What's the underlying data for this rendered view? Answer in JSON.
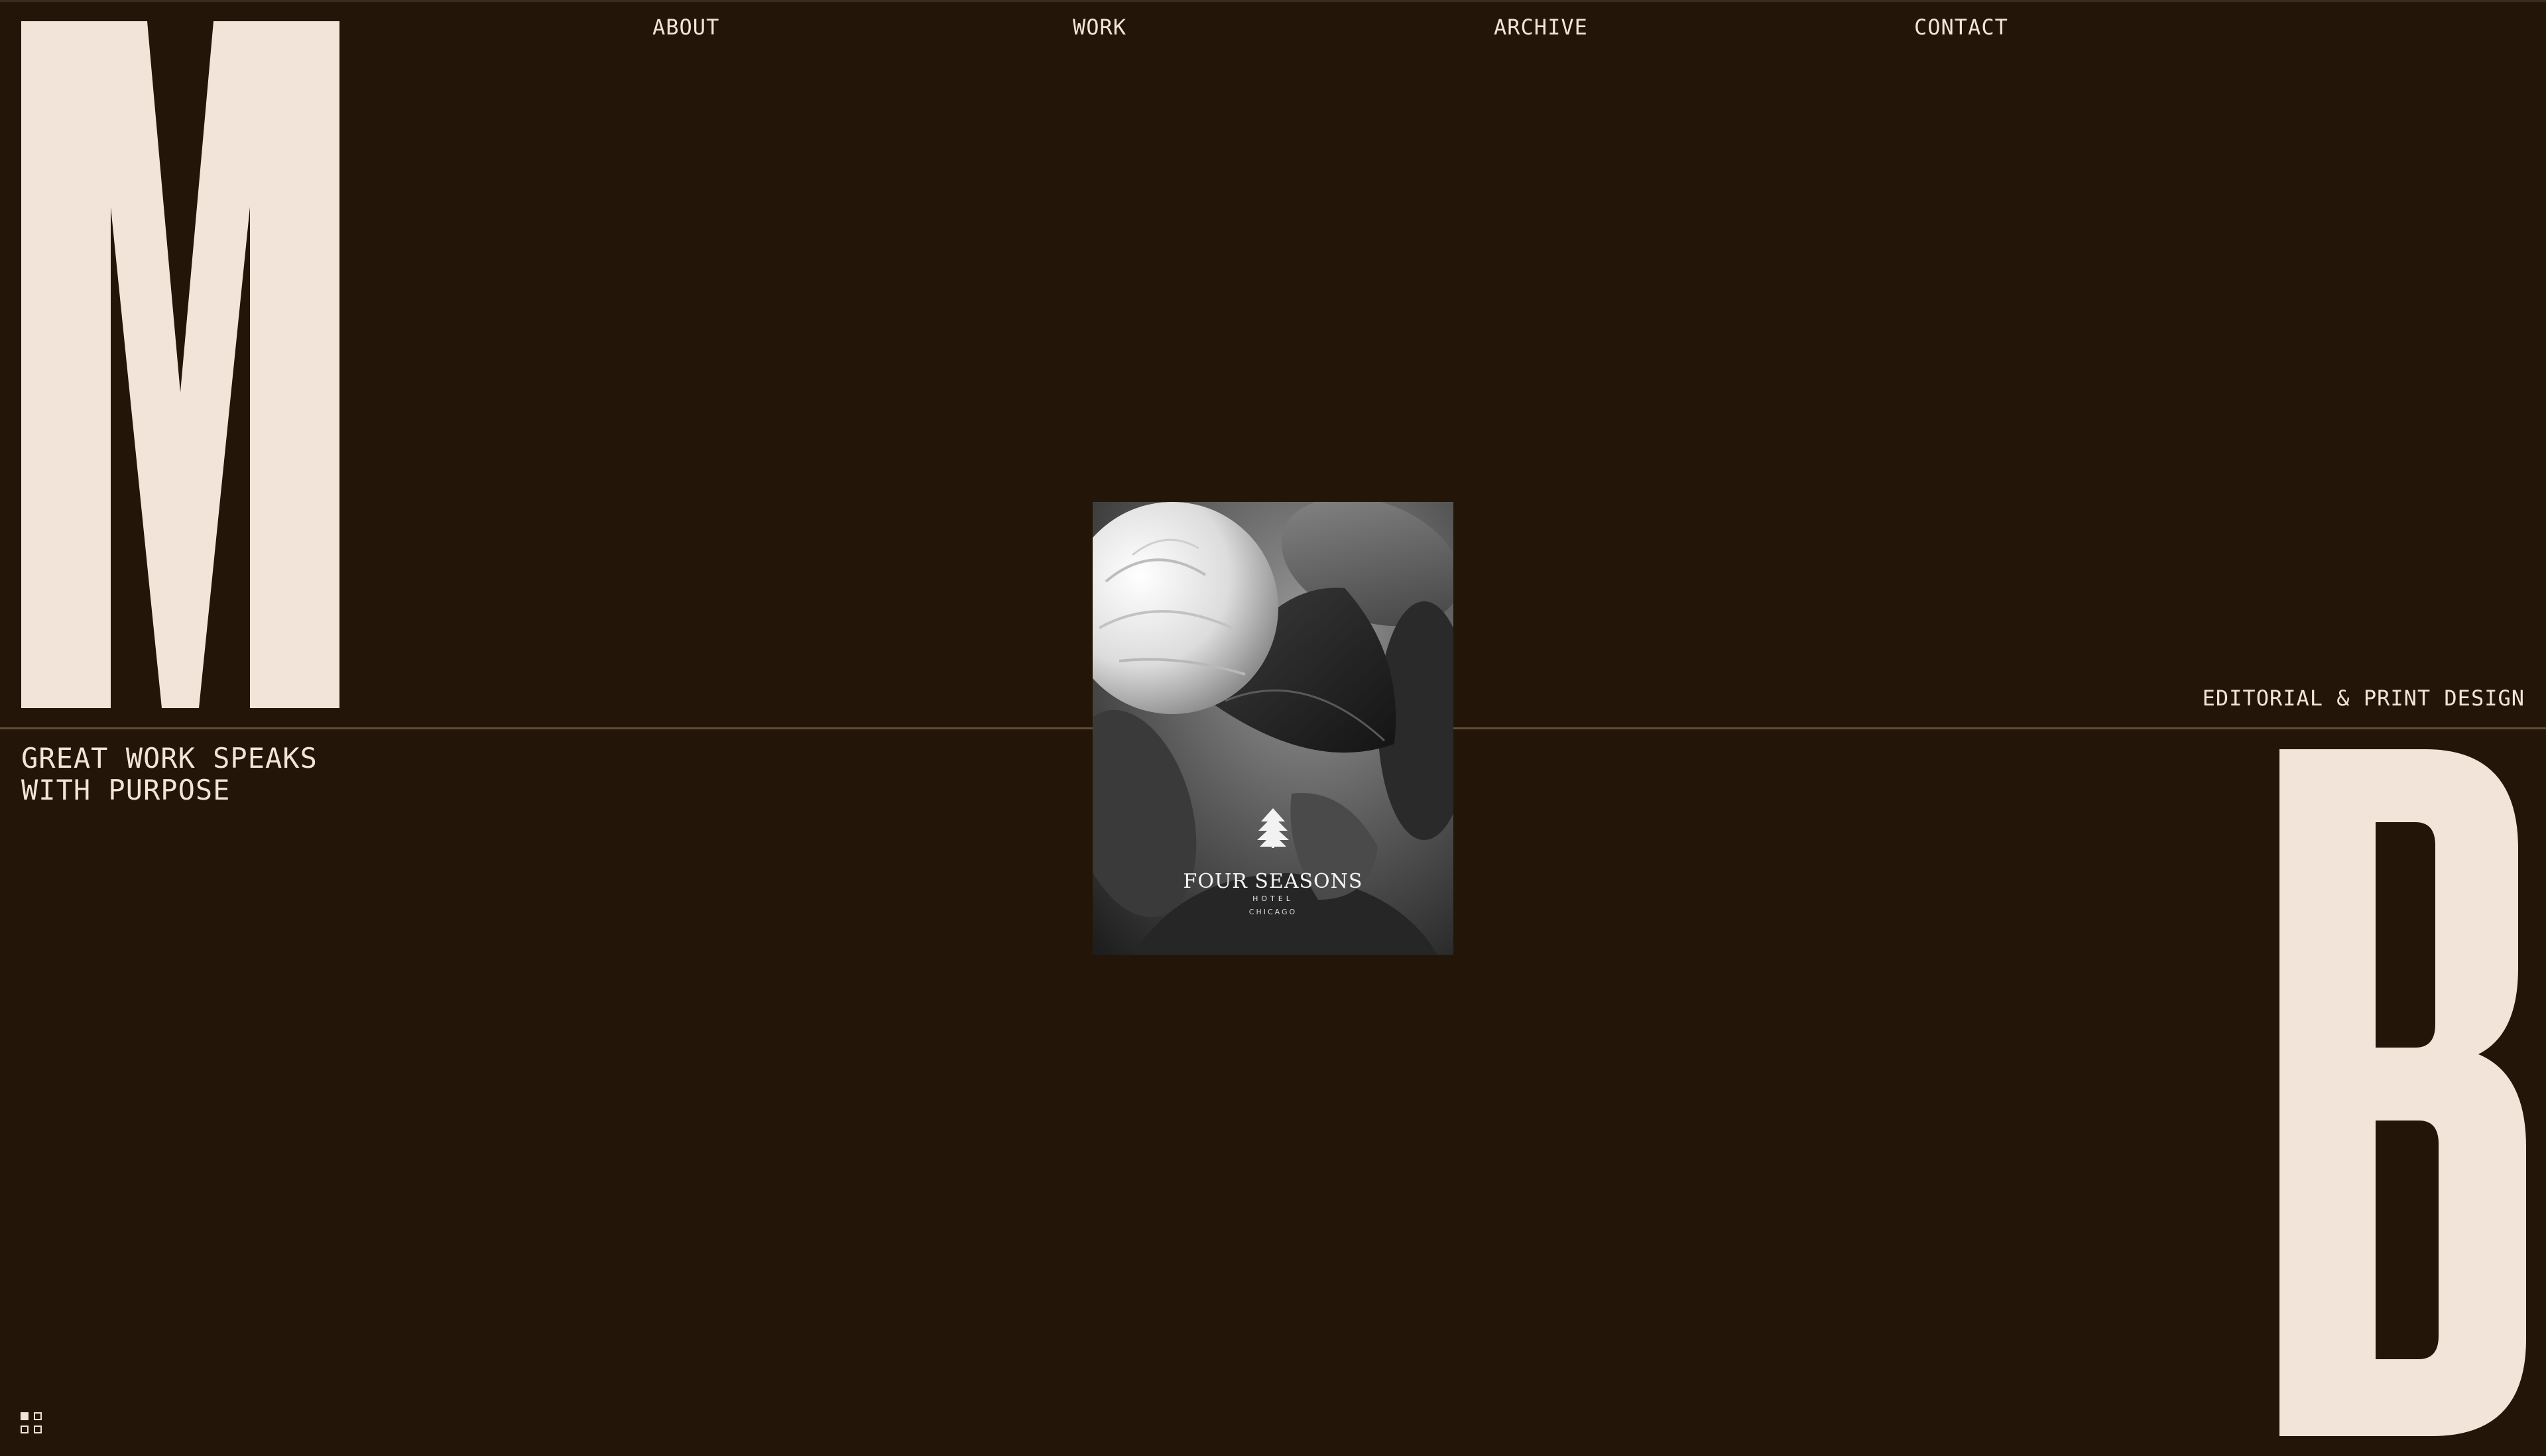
{
  "nav": {
    "about": "ABOUT",
    "work": "WORK",
    "archive": "ARCHIVE",
    "contact": "CONTACT"
  },
  "hero": {
    "letter_left": "M",
    "letter_right": "B",
    "tagline_line1": "GREAT WORK SPEAKS",
    "tagline_line2": "WITH PURPOSE",
    "discipline": "EDITORIAL & PRINT DESIGN"
  },
  "feature_image": {
    "subject": "camellia flower with leaves, black and white",
    "logo_brand": "FOUR SEASONS",
    "logo_sub": "HOTEL",
    "logo_city": "CHICAGO"
  },
  "colors": {
    "background": "#231609",
    "foreground": "#f2e4d8",
    "rule": "#5e4c36"
  },
  "icons": {
    "grid_toggle": "grid-view-icon"
  }
}
